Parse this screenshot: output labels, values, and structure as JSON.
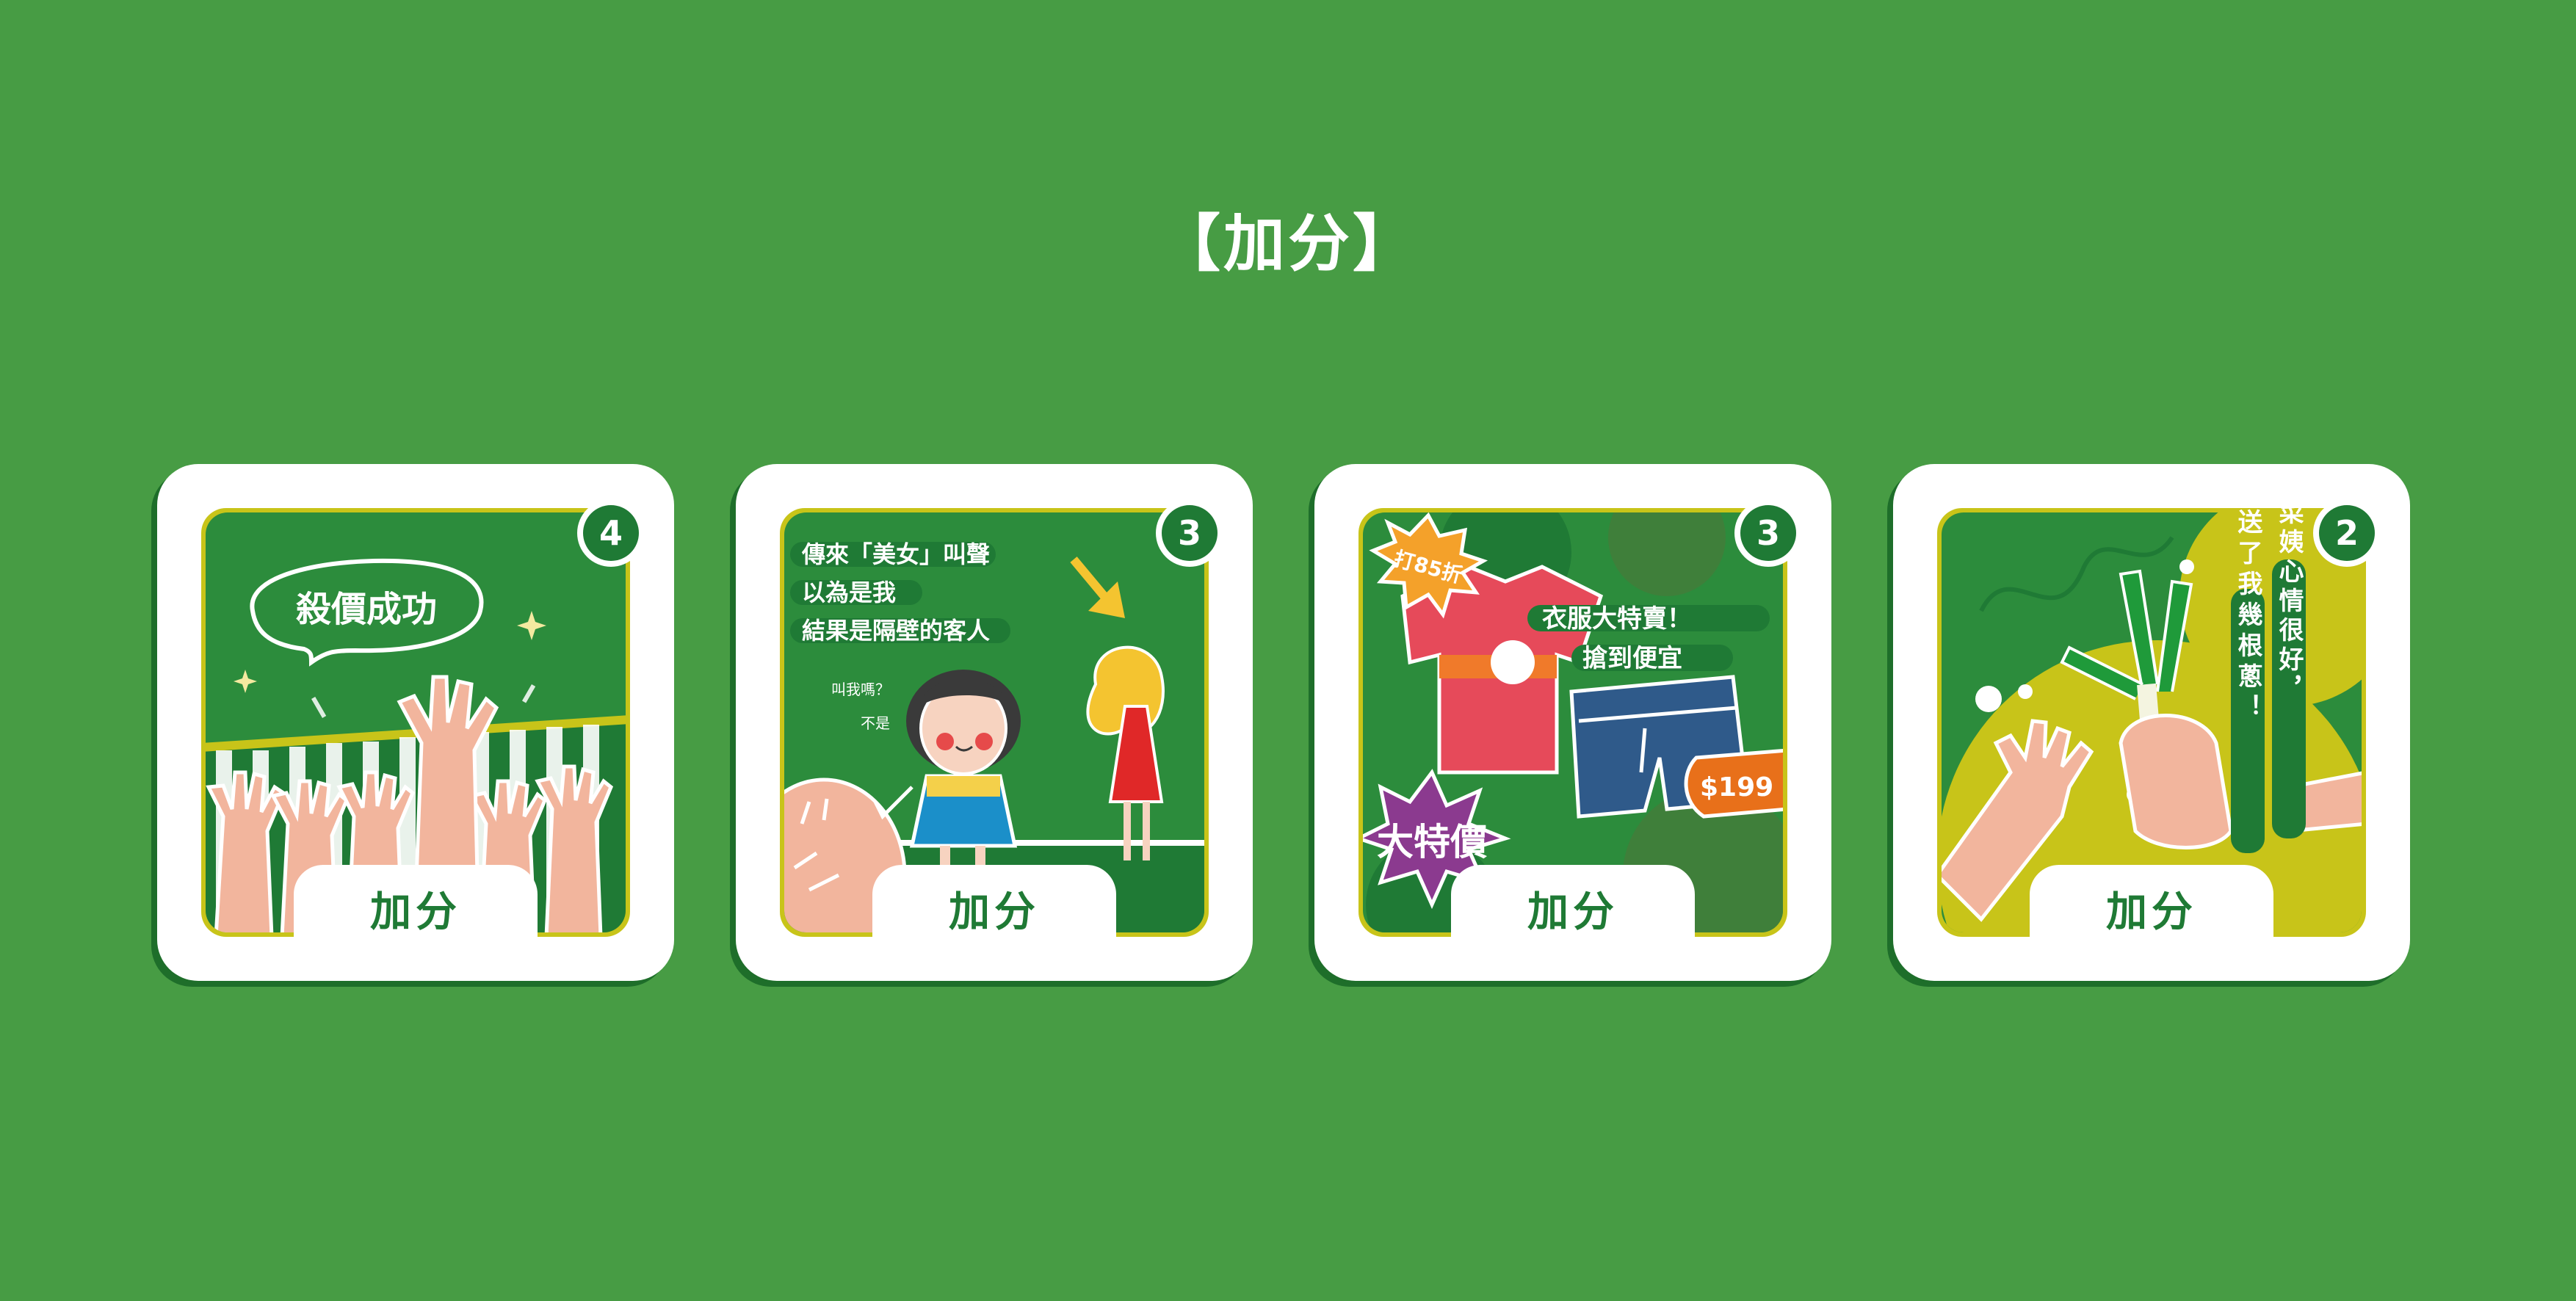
{
  "page_title": "【加分】",
  "colors": {
    "background": "#479c44",
    "card": "#ffffff",
    "card_shadow": "#1e6e2a",
    "art_frame": "#c8c419",
    "art_green": "#2c8c3c",
    "dark_green": "#1f7a35",
    "skin": "#f2b59d"
  },
  "cards": [
    {
      "badge": "4",
      "label": "加分",
      "caption": "殺價成功"
    },
    {
      "badge": "3",
      "label": "加分",
      "caption_lines": [
        "傳來「美女」叫聲",
        "以為是我",
        "結果是隔壁的客人"
      ],
      "question": "叫我嗎？",
      "answer": "不是"
    },
    {
      "badge": "3",
      "label": "加分",
      "discount": "打85折",
      "caption_lines": [
        "衣服大特賣！",
        "搶到便宜"
      ],
      "sale": "大特價",
      "price": "$199"
    },
    {
      "badge": "2",
      "label": "加分",
      "caption_col1": "蔬菜姨心情很好，",
      "caption_col2": "送了我幾根蔥！"
    }
  ]
}
